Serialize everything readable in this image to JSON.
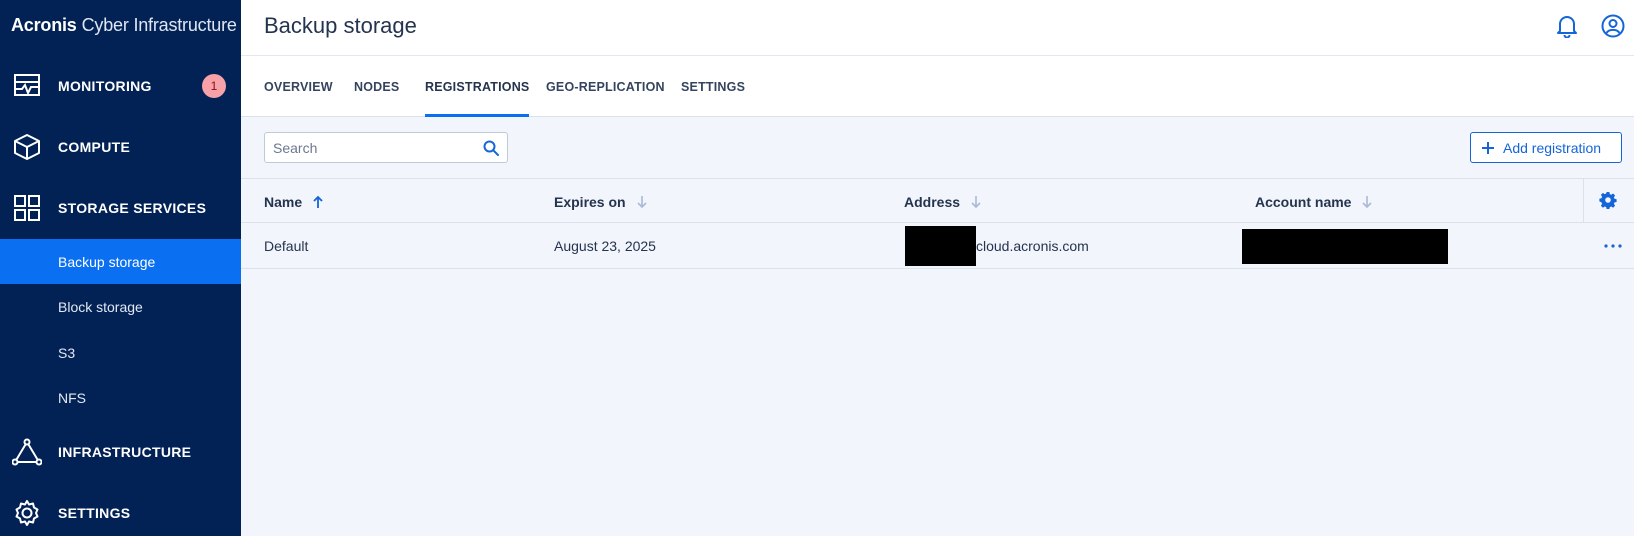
{
  "brand": {
    "name_bold": "Acronis",
    "name_light": "Cyber Infrastructure"
  },
  "sidebar": {
    "items": [
      {
        "label": "MONITORING",
        "icon": "monitoring-icon",
        "badge": "1"
      },
      {
        "label": "COMPUTE",
        "icon": "cube-icon"
      },
      {
        "label": "STORAGE SERVICES",
        "icon": "grid-icon"
      },
      {
        "label": "INFRASTRUCTURE",
        "icon": "triangle-network-icon"
      },
      {
        "label": "SETTINGS",
        "icon": "gear-icon"
      }
    ],
    "storage_sub_items": [
      {
        "label": "Backup storage",
        "active": true
      },
      {
        "label": "Block storage"
      },
      {
        "label": "S3"
      },
      {
        "label": "NFS"
      }
    ]
  },
  "header": {
    "title": "Backup storage",
    "icons": [
      "bell-icon",
      "user-icon"
    ]
  },
  "tabs": [
    {
      "label": "OVERVIEW"
    },
    {
      "label": "NODES"
    },
    {
      "label": "REGISTRATIONS",
      "active": true
    },
    {
      "label": "GEO-REPLICATION"
    },
    {
      "label": "SETTINGS"
    }
  ],
  "toolbar": {
    "search_placeholder": "Search",
    "search_value": "",
    "add_label": "Add registration"
  },
  "table": {
    "columns": [
      {
        "label": "Name",
        "sort": "asc-active"
      },
      {
        "label": "Expires on",
        "sort": "desc-inactive"
      },
      {
        "label": "Address",
        "sort": "desc-inactive"
      },
      {
        "label": "Account name",
        "sort": "desc-inactive"
      }
    ],
    "rows": [
      {
        "name": "Default",
        "expires": "August 23, 2025",
        "address_visible": "cloud.acronis.com",
        "account": ""
      }
    ]
  },
  "colors": {
    "sidebar_bg": "#022255",
    "accent": "#0a6ff0",
    "content_bg": "#f2f5fb",
    "badge_bg": "#f7a1a8"
  }
}
